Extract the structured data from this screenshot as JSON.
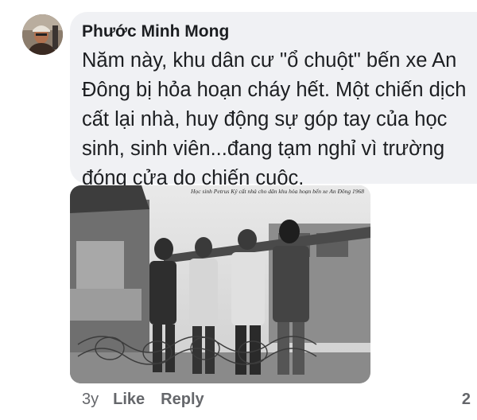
{
  "comment": {
    "author": "Phước Minh Mong",
    "text": "Năm này, khu dân cư \"ổ chuột\" bến xe An Đông bị hỏa hoạn cháy hết. Một chiến dịch cất lại nhà, huy động sự góp tay của học sinh, sinh viên...đang tạm nghỉ vì trường đóng cửa do chiến cuộc.",
    "avatar_icon": "profile-photo-icon",
    "photo": {
      "caption": "Học sinh Petrus Ký cất nhà cho dân khu hỏa hoạn bến xe An Đông 1968"
    }
  },
  "actions": {
    "time": "3y",
    "like_label": "Like",
    "reply_label": "Reply",
    "reply_count": "2"
  },
  "colors": {
    "bubble": "#f0f1f4",
    "text": "#1c1e21",
    "meta": "#65676b"
  }
}
